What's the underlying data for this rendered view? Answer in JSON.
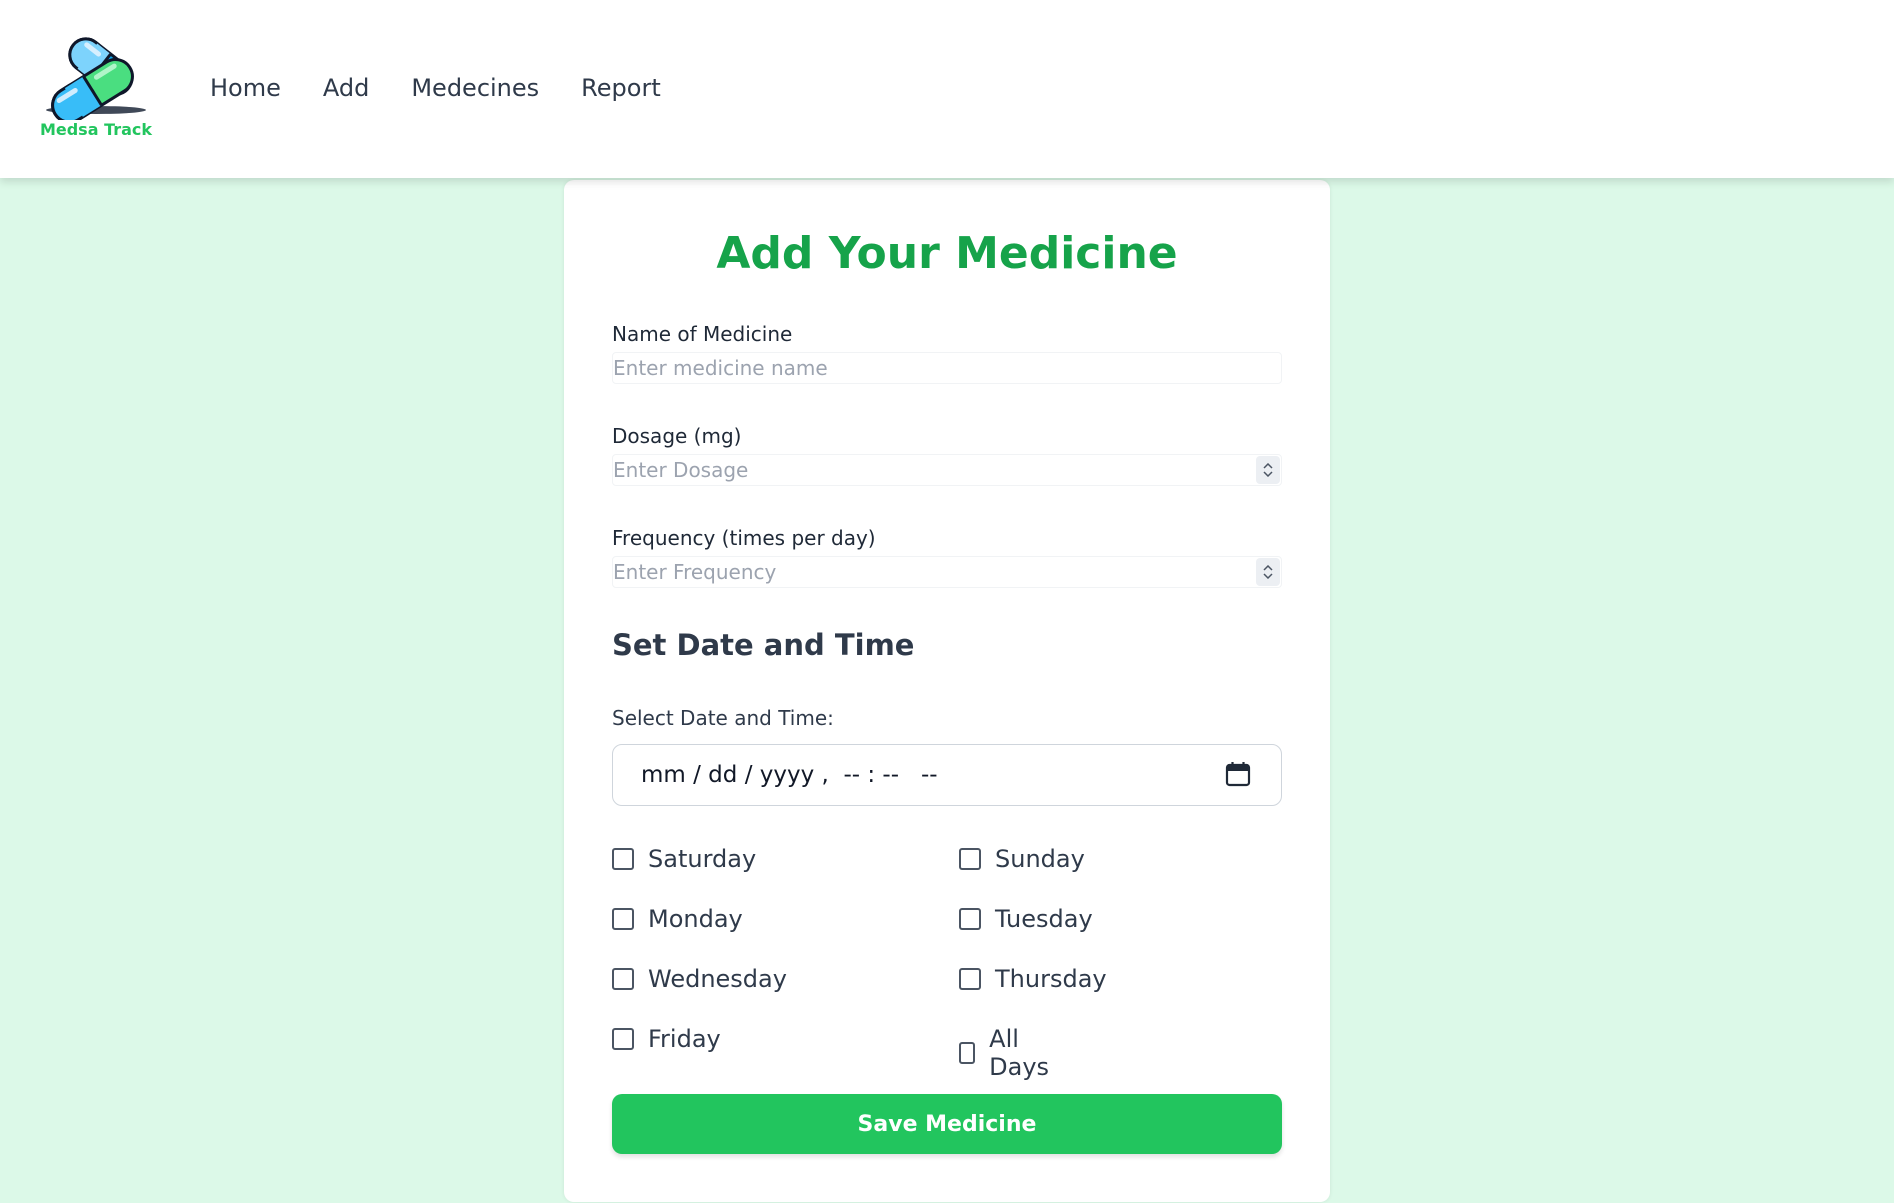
{
  "brand": {
    "name": "Medsa Track",
    "logo_icon": "pill-capsules-icon",
    "colors": {
      "blue": "#38bdf8",
      "green": "#4ade80",
      "text": "#22c55e"
    }
  },
  "nav": {
    "items": [
      {
        "label": "Home"
      },
      {
        "label": "Add"
      },
      {
        "label": "Medecines"
      },
      {
        "label": "Report"
      }
    ]
  },
  "form": {
    "title": "Add Your Medicine",
    "name": {
      "label": "Name of Medicine",
      "placeholder": "Enter medicine name",
      "value": ""
    },
    "dosage": {
      "label": "Dosage (mg)",
      "placeholder": "Enter Dosage",
      "value": ""
    },
    "frequency": {
      "label": "Frequency (times per day)",
      "placeholder": "Enter Frequency",
      "value": ""
    },
    "schedule": {
      "section_title": "Set Date and Time",
      "datetime_label": "Select Date and Time:",
      "datetime_value": "mm / dd / yyyy ,  -- : --   --",
      "calendar_icon": "calendar-icon"
    },
    "days": {
      "saturday": {
        "label": "Saturday",
        "checked": false
      },
      "sunday": {
        "label": "Sunday",
        "checked": false
      },
      "monday": {
        "label": "Monday",
        "checked": false
      },
      "tuesday": {
        "label": "Tuesday",
        "checked": false
      },
      "wednesday": {
        "label": "Wednesday",
        "checked": false
      },
      "thursday": {
        "label": "Thursday",
        "checked": false
      },
      "friday": {
        "label": "Friday",
        "checked": false
      },
      "all_days": {
        "label": "All Days",
        "checked": false
      }
    },
    "save_label": "Save Medicine"
  },
  "theme": {
    "background": "#dcf9e8",
    "accent": "#22c55e",
    "title_color": "#16a34a"
  }
}
